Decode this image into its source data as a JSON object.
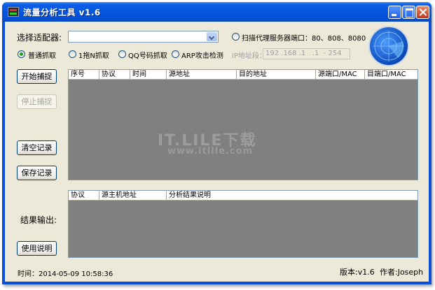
{
  "window": {
    "title": "流量分析工具 v1.6"
  },
  "adapter": {
    "label": "选择适配器:",
    "value": ""
  },
  "scan_proxy": {
    "label": "扫描代理服务器端口：80、808、8080"
  },
  "modes": [
    {
      "label": "普通抓取",
      "selected": true
    },
    {
      "label": "1拖N抓取",
      "selected": false
    },
    {
      "label": "QQ号码抓取",
      "selected": false
    },
    {
      "label": "ARP攻击检测",
      "selected": false
    }
  ],
  "ip_range": {
    "label": "IP地址段：",
    "value": "192 .168 .1   .1  - 254"
  },
  "buttons": {
    "start": "开始捕捉",
    "stop": "停止捕捉",
    "clear": "清空记录",
    "save": "保存记录",
    "help": "使用说明"
  },
  "capture_table": {
    "columns": [
      "序号",
      "协议",
      "时间",
      "源地址",
      "目的地址",
      "源端口/MAC",
      "目端口/MAC"
    ]
  },
  "result_table": {
    "columns": [
      "协议",
      "源主机地址",
      "分析结果说明"
    ]
  },
  "result_label": "结果输出:",
  "status": {
    "time": "时间：2014-05-09 10:58:36",
    "version": "版本:v1.6",
    "author": "作者:Joseph"
  },
  "watermark": {
    "line1": "IT.LILE下载",
    "line2": "www.itlile.com"
  },
  "colors": {
    "title_bar": "#0656e0",
    "client_bg": "#ece9d8",
    "grid_bg": "#808080"
  }
}
